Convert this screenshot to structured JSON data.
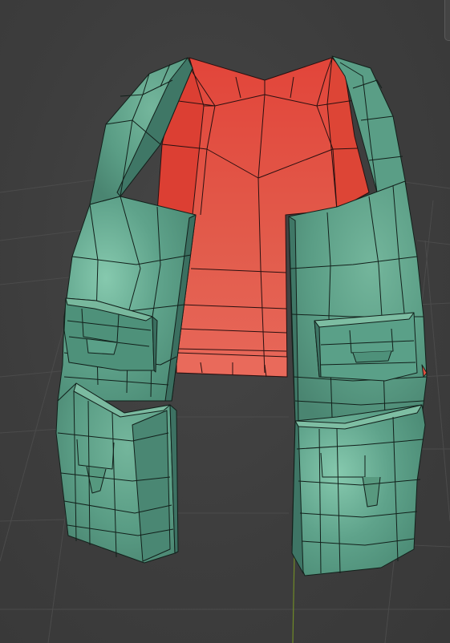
{
  "viewport": {
    "background_color": "#3d3d3d",
    "grid_color": "#4b4b4b",
    "axis_y_color": "#6f8a27"
  },
  "mesh": {
    "object": "vest",
    "body_color": "#5fa38b",
    "body_dark_color": "#4a8571",
    "body_light_color": "#7cc0a6",
    "selected_faces_color": "#e0503f",
    "selected_dark_color": "#c63a2f",
    "edge_color": "#1a2a24"
  },
  "icons": [
    "scroll-nub-icon"
  ]
}
